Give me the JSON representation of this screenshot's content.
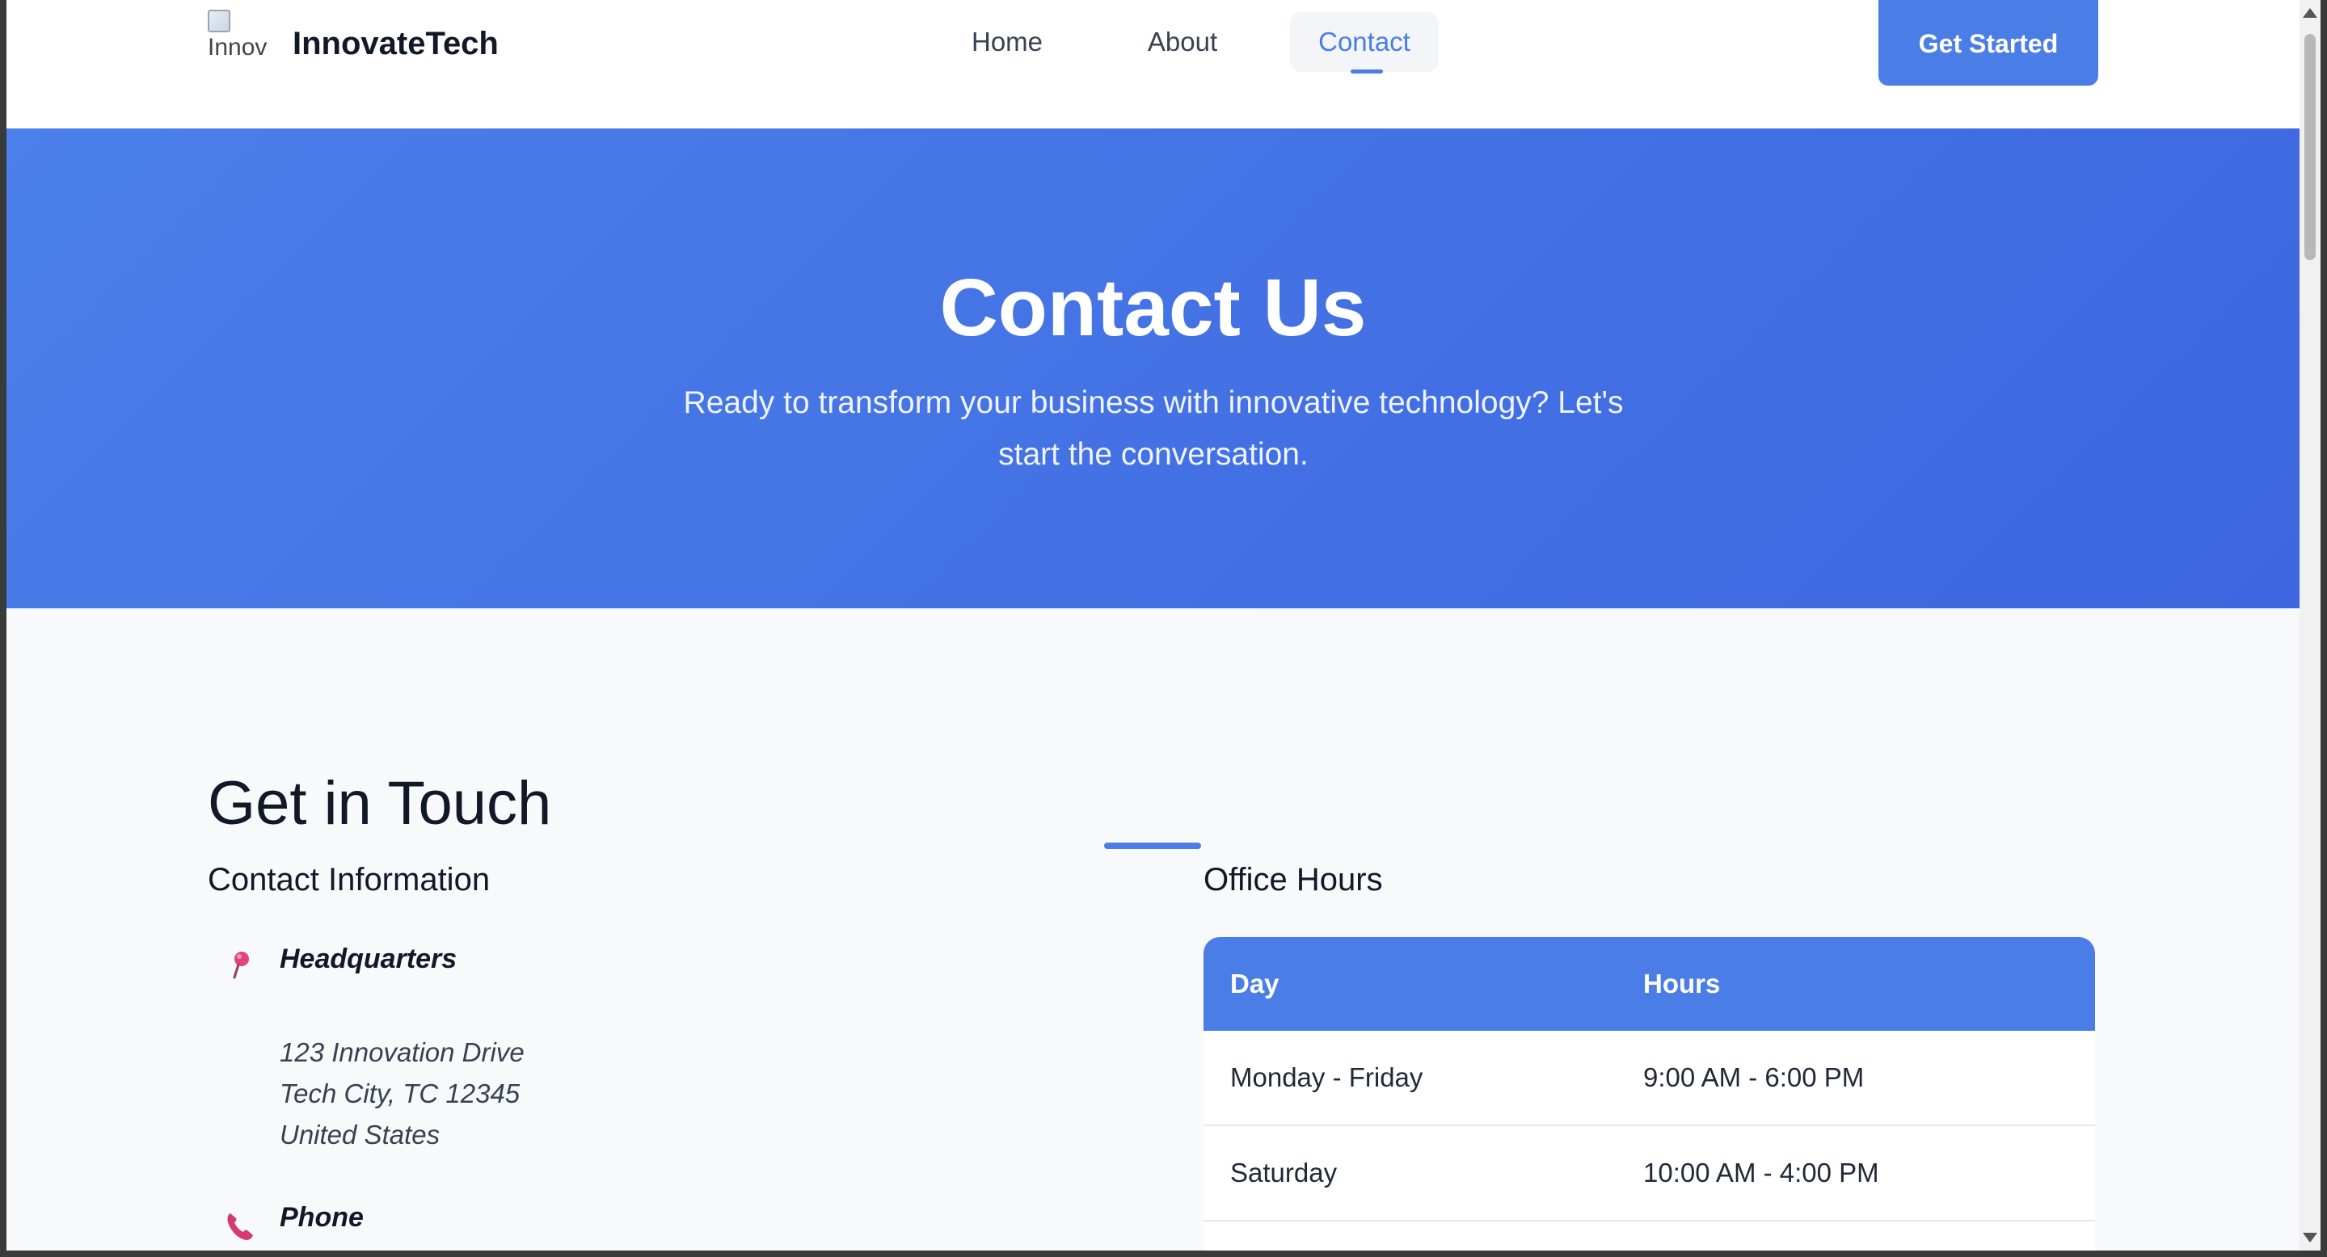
{
  "header": {
    "logo_alt": "Innov",
    "brand": "InnovateTech",
    "nav": [
      {
        "label": "Home",
        "active": false
      },
      {
        "label": "About",
        "active": false
      },
      {
        "label": "Contact",
        "active": true
      }
    ],
    "cta_label": "Get Started"
  },
  "hero": {
    "title": "Contact Us",
    "subtitle": "Ready to transform your business with innovative technology? Let's start the conversation."
  },
  "main": {
    "section_title": "Get in Touch",
    "contact_info": {
      "title": "Contact Information",
      "items": [
        {
          "icon": "map-pin-icon",
          "label": "Headquarters",
          "lines": [
            "123 Innovation Drive",
            "Tech City, TC 12345",
            "United States"
          ]
        },
        {
          "icon": "phone-icon",
          "label": "Phone",
          "lines": []
        }
      ]
    },
    "office_hours": {
      "title": "Office Hours",
      "headers": [
        "Day",
        "Hours"
      ],
      "rows": [
        [
          "Monday - Friday",
          "9:00 AM - 6:00 PM"
        ],
        [
          "Saturday",
          "10:00 AM - 4:00 PM"
        ]
      ]
    }
  },
  "colors": {
    "accent": "#4a7ee6",
    "hero_start": "#4b7fe9",
    "hero_end": "#3d66e0",
    "page_bg": "#f8f9fb",
    "text_dark": "#111827"
  }
}
